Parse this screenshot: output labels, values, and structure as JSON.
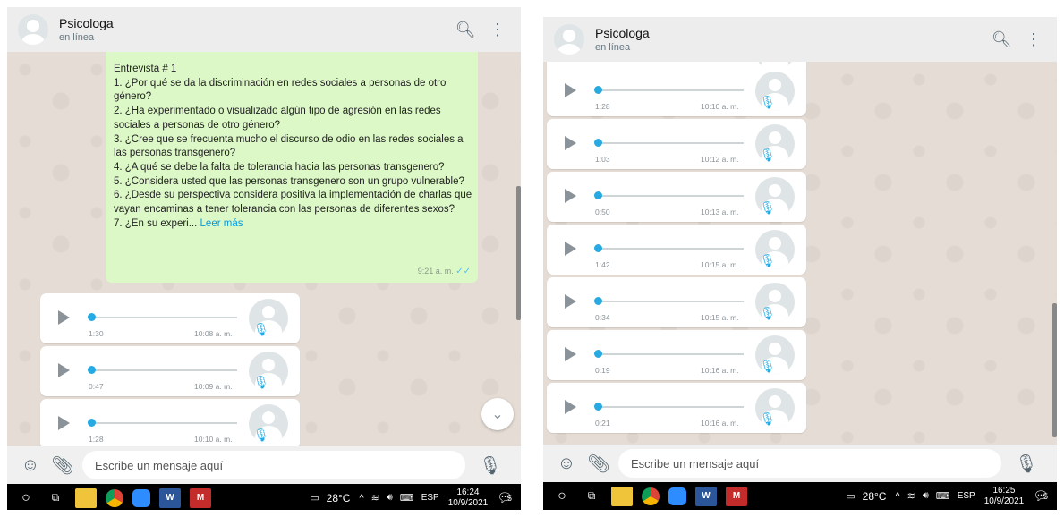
{
  "contact": {
    "name": "Psicologa",
    "status": "en línea"
  },
  "icons": {
    "search": "search-icon",
    "menu": "menu-icon",
    "emoji": "emoji-icon",
    "attach": "attach-icon",
    "mic": "mic-icon",
    "scroll_down": "chevron-down-icon"
  },
  "text_message": {
    "lines": [
      "Entrevista # 1",
      "1.    ¿Por qué se da la discriminación en redes sociales a personas de otro género?",
      "2.    ¿Ha experimentado o visualizado algún tipo de agresión en las redes sociales a personas de otro género?",
      "3.    ¿Cree que se frecuenta mucho el discurso de odio en las redes sociales a las personas transgenero?",
      "4.    ¿A qué se debe la falta de tolerancia hacia las personas transgenero?",
      "5.    ¿Considera usted que las personas transgenero son un grupo vulnerable?",
      "6.    ¿Desde su perspectiva considera positiva la implementación de charlas que vayan encaminas a tener tolerancia con las personas de diferentes sexos?"
    ],
    "last_line": "7.    ¿En su experi...",
    "read_more": "Leer más",
    "time": "9:21 a. m."
  },
  "left_voice": [
    {
      "duration": "1:30",
      "time": "10:08 a. m."
    },
    {
      "duration": "0:47",
      "time": "10:09 a. m."
    },
    {
      "duration": "1:28",
      "time": "10:10 a. m."
    }
  ],
  "right_voice": [
    {
      "duration": "1:28",
      "time": "10:10 a. m."
    },
    {
      "duration": "1:03",
      "time": "10:12 a. m."
    },
    {
      "duration": "0:50",
      "time": "10:13 a. m."
    },
    {
      "duration": "1:42",
      "time": "10:15 a. m."
    },
    {
      "duration": "0:34",
      "time": "10:15 a. m."
    },
    {
      "duration": "0:19",
      "time": "10:16 a. m."
    },
    {
      "duration": "0:21",
      "time": "10:16 a. m."
    }
  ],
  "compose": {
    "placeholder": "Escribe un mensaje aquí"
  },
  "taskbar": {
    "word_label": "W",
    "weather": "28°C",
    "lang": "ESP",
    "left_clock": {
      "time": "16:24",
      "date": "10/9/2021"
    },
    "right_clock": {
      "time": "16:25",
      "date": "10/9/2021"
    },
    "notifications": "5"
  }
}
